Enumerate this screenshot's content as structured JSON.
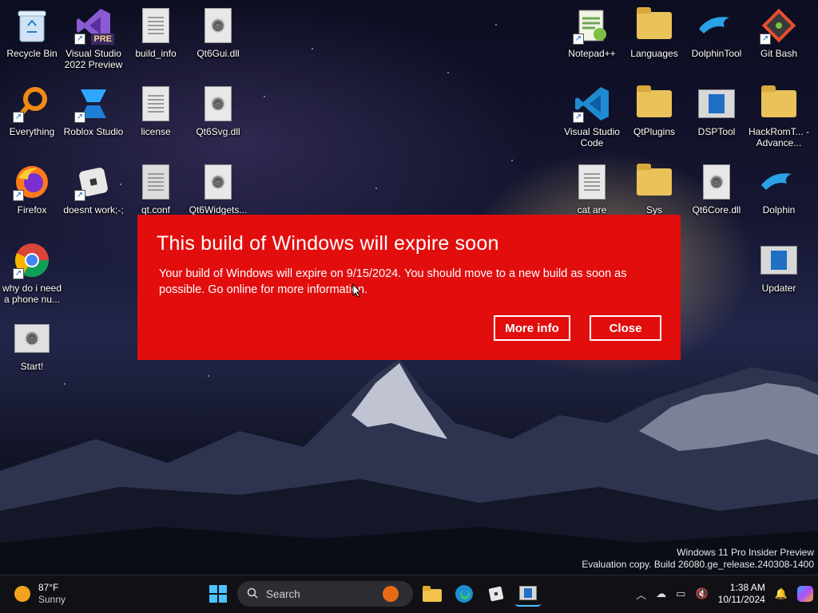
{
  "desktop": {
    "left_icons": [
      {
        "label": "Recycle Bin",
        "icon": "recycle-bin-icon"
      },
      {
        "label": "Visual Studio 2022 Preview",
        "icon": "visual-studio-preview-icon",
        "badge": "PRE"
      },
      {
        "label": "build_info",
        "icon": "text-file-icon"
      },
      {
        "label": "Qt6Gui.dll",
        "icon": "dll-file-icon"
      },
      {
        "label": "Everything",
        "icon": "everything-search-icon"
      },
      {
        "label": "Roblox Studio",
        "icon": "roblox-studio-icon"
      },
      {
        "label": "license",
        "icon": "text-file-icon"
      },
      {
        "label": "Qt6Svg.dll",
        "icon": "dll-file-icon"
      },
      {
        "label": "Firefox",
        "icon": "firefox-icon"
      },
      {
        "label": "doesnt work;-;",
        "icon": "roblox-icon"
      },
      {
        "label": "qt.conf",
        "icon": "text-file-icon"
      },
      {
        "label": "Qt6Widgets...",
        "icon": "dll-file-icon"
      },
      {
        "label": "why do i need a phone nu...",
        "icon": "chrome-icon"
      },
      {
        "label": "Start!",
        "icon": "app-icon"
      }
    ],
    "right_icons": [
      {
        "label": "Notepad++",
        "icon": "notepad-plus-plus-icon"
      },
      {
        "label": "Languages",
        "icon": "folder-icon"
      },
      {
        "label": "DolphinTool",
        "icon": "dolphin-icon"
      },
      {
        "label": "Git Bash",
        "icon": "git-bash-icon"
      },
      {
        "label": "Visual Studio Code",
        "icon": "vscode-icon"
      },
      {
        "label": "QtPlugins",
        "icon": "folder-icon"
      },
      {
        "label": "DSPTool",
        "icon": "app-window-icon"
      },
      {
        "label": "HackRomT... - Advance...",
        "icon": "folder-icon"
      },
      {
        "label": "cat are",
        "icon": "text-file-icon"
      },
      {
        "label": "Sys",
        "icon": "folder-icon"
      },
      {
        "label": "Qt6Core.dll",
        "icon": "dll-file-icon"
      },
      {
        "label": "Dolphin",
        "icon": "dolphin-icon"
      },
      {
        "label": "Updater",
        "icon": "app-window-icon"
      }
    ]
  },
  "dialog": {
    "title": "This build of Windows will expire soon",
    "message": "Your build of Windows will expire on 9/15/2024. You should move to a new build as soon as possible. Go online for more information.",
    "more_info_label": "More info",
    "close_label": "Close",
    "background_color": "#e20e0e"
  },
  "watermark": {
    "line1": "Windows 11 Pro Insider Preview",
    "line2": "Evaluation copy. Build 26080.ge_release.240308-1400"
  },
  "taskbar": {
    "weather": {
      "temp": "87°F",
      "condition": "Sunny"
    },
    "search_placeholder": "Search",
    "pinned": [
      "start-icon",
      "file-explorer-icon",
      "edge-icon",
      "roblox-icon",
      "dsptool-icon"
    ],
    "tray": {
      "time": "1:38 AM",
      "date": "10/11/2024"
    }
  }
}
